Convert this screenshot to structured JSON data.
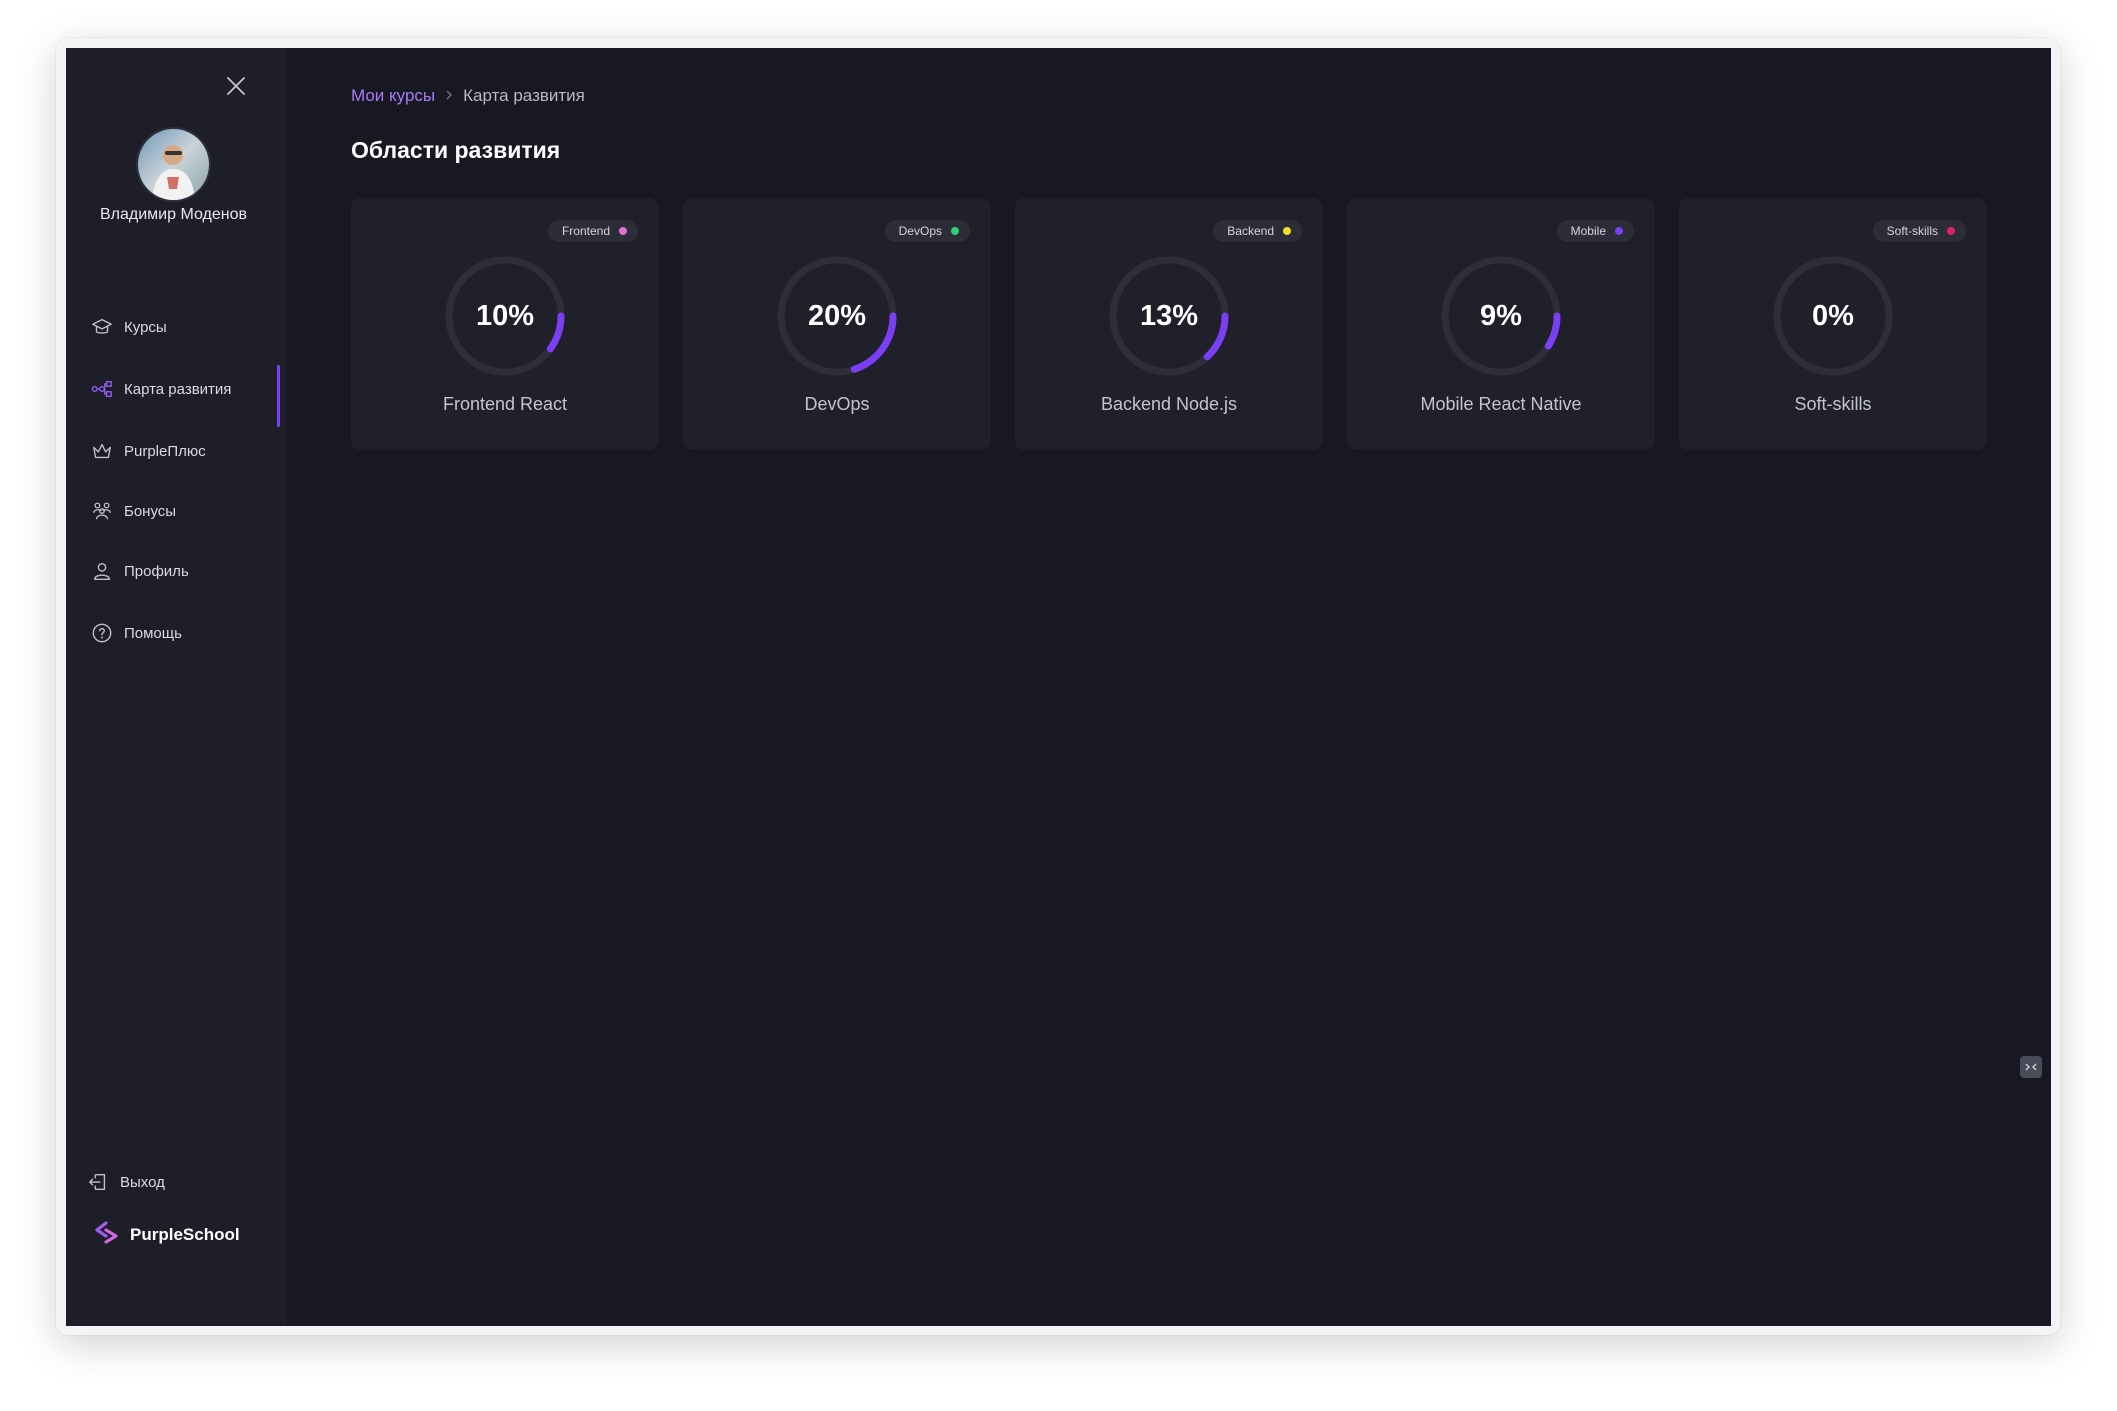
{
  "user": {
    "name": "Владимир Моденов"
  },
  "nav": {
    "items": [
      {
        "label": "Курсы",
        "icon": "graduation-cap-icon"
      },
      {
        "label": "Карта развития",
        "icon": "tree-map-icon"
      },
      {
        "label": "PurpleПлюс",
        "icon": "crown-icon"
      },
      {
        "label": "Бонусы",
        "icon": "group-icon"
      },
      {
        "label": "Профиль",
        "icon": "user-icon"
      },
      {
        "label": "Помощь",
        "icon": "help-circle-icon"
      }
    ],
    "active": "Карта развития",
    "logout": "Выход"
  },
  "brand": {
    "name": "PurpleSchool"
  },
  "breadcrumb": {
    "link": "Мои курсы",
    "current": "Карта развития"
  },
  "page": {
    "title": "Области развития"
  },
  "colors": {
    "accent": "#7a3ff2",
    "background": "#171821",
    "sidebar": "#1d1e27",
    "card": "#1f202a"
  },
  "cards": [
    {
      "tag": "Frontend",
      "tag_color": "#e36fd0",
      "percent_label": "10%",
      "progress": 0.1,
      "name": "Frontend React"
    },
    {
      "tag": "DevOps",
      "tag_color": "#2ecf74",
      "percent_label": "20%",
      "progress": 0.2,
      "name": "DevOps"
    },
    {
      "tag": "Backend",
      "tag_color": "#f2e12a",
      "percent_label": "13%",
      "progress": 0.13,
      "name": "Backend Node.js"
    },
    {
      "tag": "Mobile",
      "tag_color": "#7a3ff2",
      "percent_label": "9%",
      "progress": 0.09,
      "name": "Mobile React Native"
    },
    {
      "tag": "Soft-skills",
      "tag_color": "#e0206f",
      "percent_label": "0%",
      "progress": 0.0,
      "name": "Soft-skills"
    }
  ]
}
